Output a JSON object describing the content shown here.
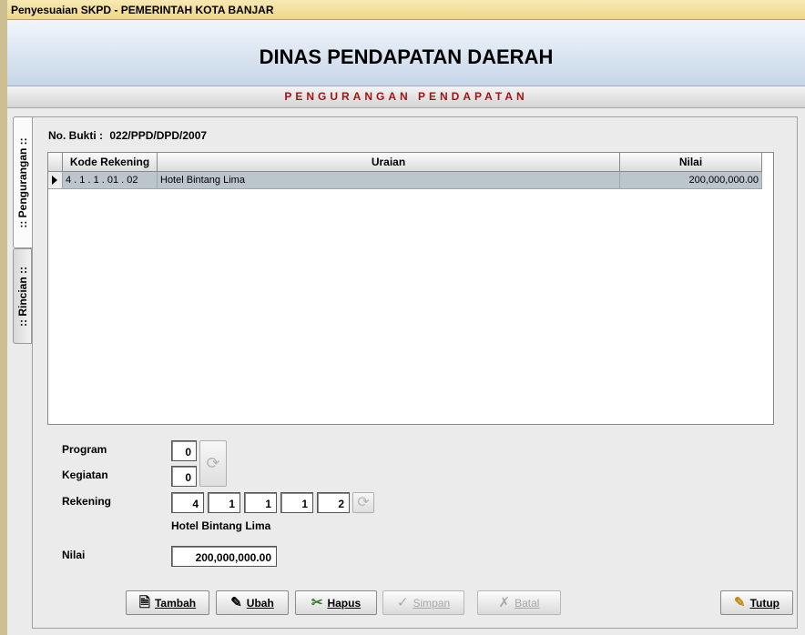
{
  "window": {
    "title": "Penyesuaian SKPD - PEMERINTAH KOTA BANJAR"
  },
  "header": {
    "title": "DINAS PENDAPATAN DAERAH",
    "subtitle": "PENGURANGAN PENDAPATAN"
  },
  "tabs": [
    {
      "label": ":: Pengurangan ::",
      "active": true
    },
    {
      "label": ":: Rincian ::",
      "active": false
    }
  ],
  "bukti": {
    "label": "No. Bukti  :",
    "value": "022/PPD/DPD/2007"
  },
  "grid": {
    "columns": [
      "Kode Rekening",
      "Uraian",
      "Nilai"
    ],
    "rows": [
      {
        "kode": "4 . 1 . 1 . 01 . 02",
        "uraian": "Hotel Bintang Lima",
        "nilai": "200,000,000.00",
        "selected": true
      }
    ]
  },
  "form": {
    "program_label": "Program",
    "program_value": "0",
    "kegiatan_label": "Kegiatan",
    "kegiatan_value": "0",
    "rekening_label": "Rekening",
    "rekening_values": [
      "4",
      "1",
      "1",
      "1",
      "2"
    ],
    "rekening_name": "Hotel Bintang Lima",
    "nilai_label": "Nilai",
    "nilai_value": "200,000,000.00"
  },
  "buttons": {
    "tambah": {
      "label": "Tambah",
      "icon": "add-icon",
      "enabled": true
    },
    "ubah": {
      "label": "Ubah",
      "icon": "edit-icon",
      "enabled": true
    },
    "hapus": {
      "label": "Hapus",
      "icon": "delete-icon",
      "enabled": true
    },
    "simpan": {
      "label": "Simpan",
      "icon": "check-icon",
      "enabled": false
    },
    "batal": {
      "label": "Batal",
      "icon": "cancel-icon",
      "enabled": false
    },
    "tutup": {
      "label": "Tutup",
      "icon": "close-icon",
      "enabled": true
    }
  },
  "colors": {
    "accent_red": "#a11414",
    "row_selected": "#bcc4cc",
    "titlebar": "#efd78a"
  }
}
